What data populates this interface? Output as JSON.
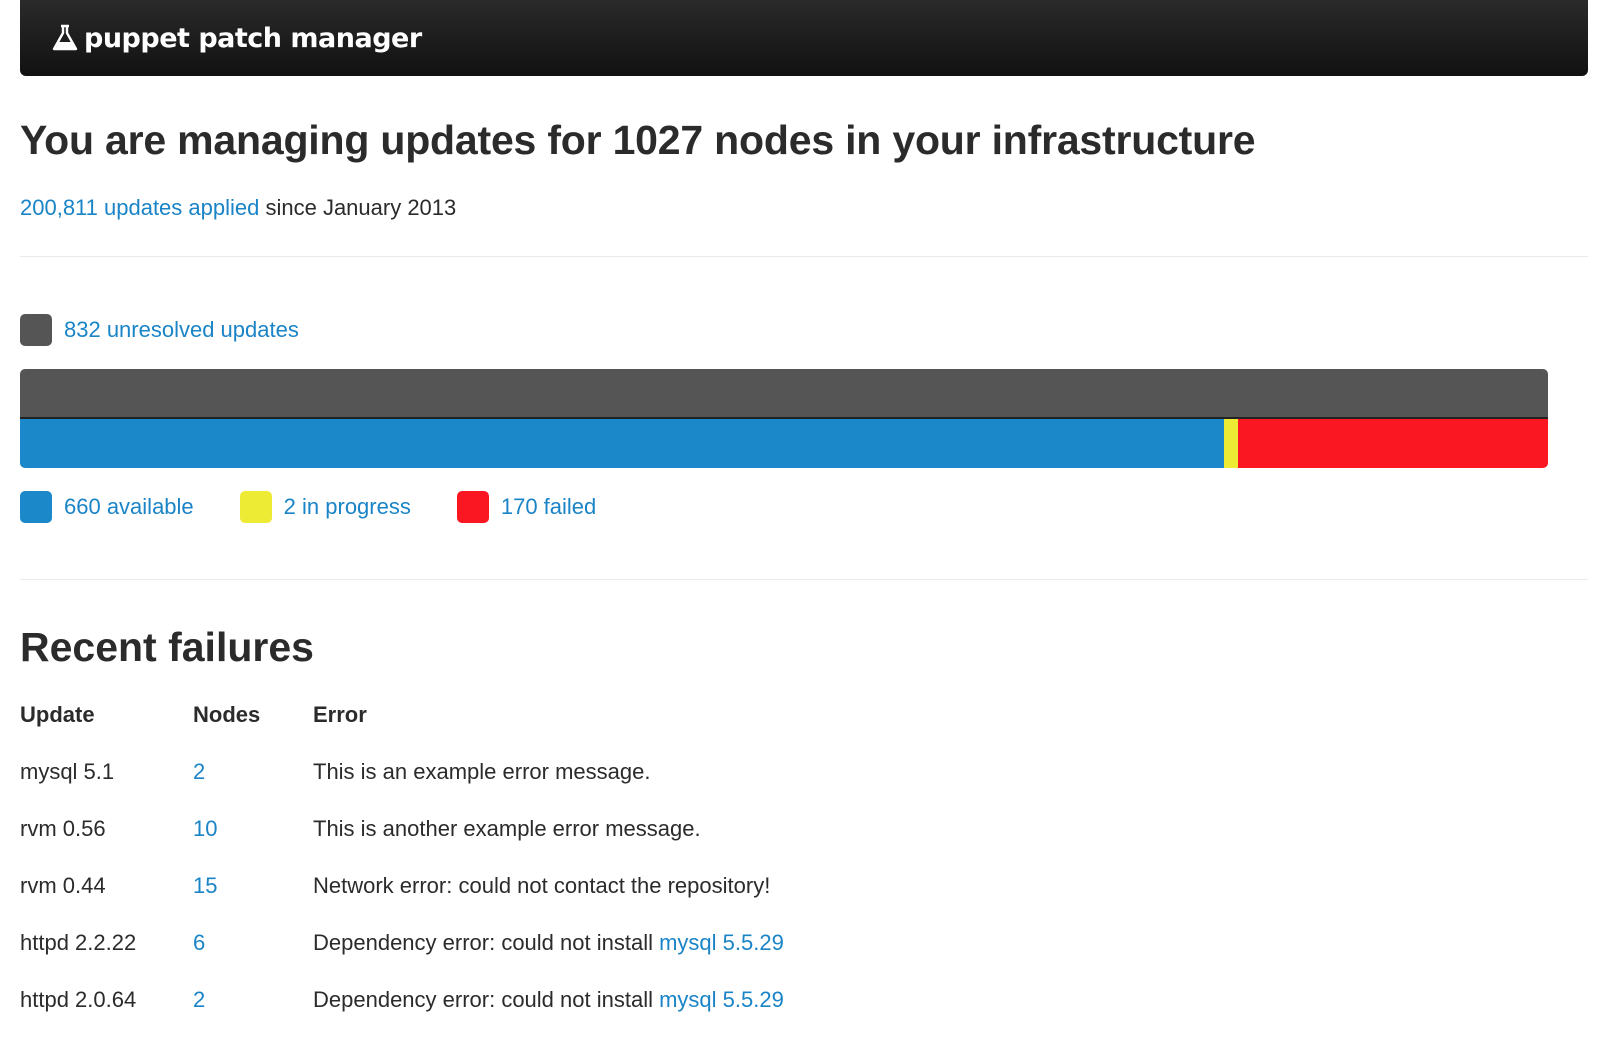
{
  "header": {
    "brand": "puppet patch manager",
    "logo_icon": "puppet-flask-icon"
  },
  "summary": {
    "headline": "You are managing updates for 1027 nodes in your infrastructure",
    "applied_link": "200,811 updates applied",
    "applied_rest": " since January 2013"
  },
  "unresolved": {
    "label": "832 unresolved updates",
    "color": "#555555"
  },
  "breakdown": {
    "total": 832,
    "items": [
      {
        "label": "660 available",
        "value": 660,
        "color": "#1a88c9"
      },
      {
        "label": "2 in progress",
        "value": 2,
        "color": "#eeeb34"
      },
      {
        "label": "170 failed",
        "value": 170,
        "color": "#fb1721"
      }
    ]
  },
  "failures": {
    "title": "Recent failures",
    "columns": [
      "Update",
      "Nodes",
      "Error"
    ],
    "rows": [
      {
        "update": "mysql 5.1",
        "nodes": "2",
        "error": "This is an example error message.",
        "error_link": ""
      },
      {
        "update": "rvm 0.56",
        "nodes": "10",
        "error": "This is another example error message.",
        "error_link": ""
      },
      {
        "update": "rvm 0.44",
        "nodes": "15",
        "error": "Network error: could not contact the repository!",
        "error_link": ""
      },
      {
        "update": "httpd 2.2.22",
        "nodes": "6",
        "error": "Dependency error: could not install ",
        "error_link": "mysql 5.5.29"
      },
      {
        "update": "httpd 2.0.64",
        "nodes": "2",
        "error": "Dependency error: could not install ",
        "error_link": "mysql 5.5.29"
      }
    ]
  }
}
